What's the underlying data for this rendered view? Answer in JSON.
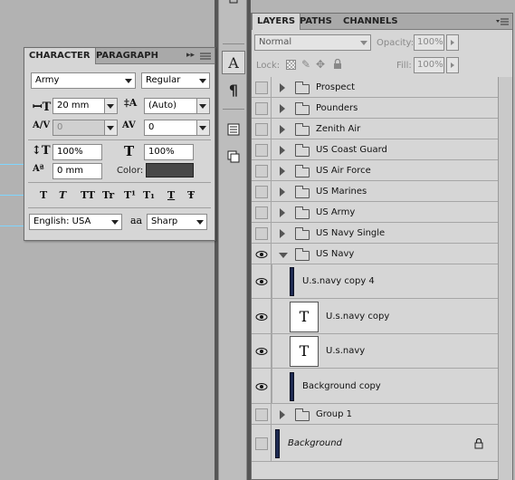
{
  "character_panel": {
    "tabs": [
      "CHARACTER",
      "PARAGRAPH"
    ],
    "menu_glyph": "▸▸",
    "font_family": "Army",
    "font_style": "Regular",
    "font_size": "20 mm",
    "leading": "(Auto)",
    "kerning": "0",
    "tracking": "0",
    "vertical_scale": "100%",
    "horizontal_scale": "100%",
    "baseline_shift": "0 mm",
    "color_label": "Color:",
    "color_value": "#474747",
    "style_buttons": [
      "T",
      "T",
      "TT",
      "Tr",
      "T¹",
      "T₁",
      "T",
      "Ŧ"
    ],
    "language": "English: USA",
    "aa_label": "aa",
    "antialias": "Sharp"
  },
  "tools": {
    "type_tool_glyph": "A",
    "paragraph_glyph": "¶"
  },
  "layers_panel": {
    "tabs": [
      "LAYERS",
      "PATHS",
      "CHANNELS"
    ],
    "blend_mode": "Normal",
    "opacity_label": "Opacity:",
    "opacity_value": "100%",
    "lock_label": "Lock:",
    "fill_label": "Fill:",
    "fill_value": "100%",
    "layers": [
      {
        "name": "Prospect",
        "type": "group",
        "expanded": false,
        "visible": false
      },
      {
        "name": "Pounders",
        "type": "group",
        "expanded": false,
        "visible": false
      },
      {
        "name": "Zenith Air",
        "type": "group",
        "expanded": false,
        "visible": false
      },
      {
        "name": "US Coast Guard",
        "type": "group",
        "expanded": false,
        "visible": false
      },
      {
        "name": "US Air Force",
        "type": "group",
        "expanded": false,
        "visible": false
      },
      {
        "name": "US Marines",
        "type": "group",
        "expanded": false,
        "visible": false
      },
      {
        "name": "US Army",
        "type": "group",
        "expanded": false,
        "visible": false
      },
      {
        "name": "US Navy Single",
        "type": "group",
        "expanded": false,
        "visible": false
      },
      {
        "name": "US Navy",
        "type": "group",
        "expanded": true,
        "visible": true
      },
      {
        "name": "U.s.navy copy 4",
        "type": "image",
        "visible": true
      },
      {
        "name": "U.s.navy copy",
        "type": "text",
        "visible": true
      },
      {
        "name": "U.s.navy",
        "type": "text",
        "visible": true
      },
      {
        "name": "Background copy",
        "type": "image",
        "visible": true
      },
      {
        "name": "Group 1",
        "type": "group",
        "expanded": false,
        "visible": false
      },
      {
        "name": "Background",
        "type": "background",
        "visible": false,
        "locked": true
      }
    ]
  }
}
